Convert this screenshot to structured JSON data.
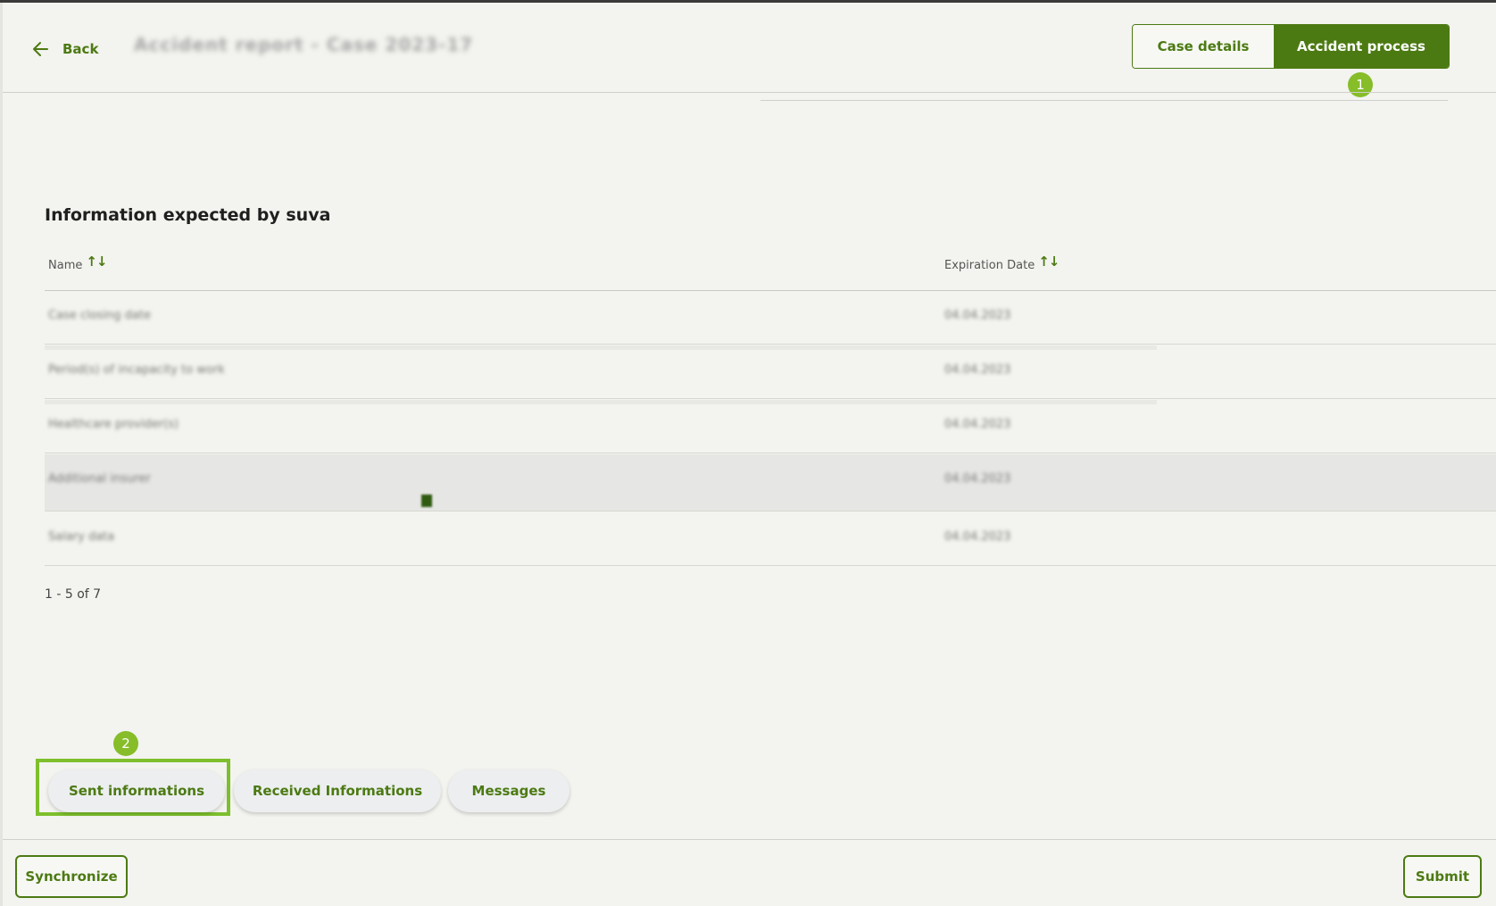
{
  "header": {
    "back_label": "Back",
    "case_title": "Accident report - Case 2023-17",
    "tabs": [
      {
        "label": "Case details",
        "active": false
      },
      {
        "label": "Accident process",
        "active": true
      }
    ]
  },
  "badges": {
    "one": "1",
    "two": "2"
  },
  "table": {
    "title": "Information expected by suva",
    "columns": [
      {
        "label": "Name",
        "sort_icon": "↑↓"
      },
      {
        "label": "Expiration Date",
        "sort_icon": "↑↓"
      }
    ],
    "rows": [
      {
        "name": "Case closing date",
        "date": "04.04.2023"
      },
      {
        "name": "Period(s) of incapacity to work",
        "date": "04.04.2023"
      },
      {
        "name": "Healthcare provider(s)",
        "date": "04.04.2023"
      },
      {
        "name": "Additional insurer",
        "date": "04.04.2023"
      },
      {
        "name": "Salary data",
        "date": "04.04.2023"
      }
    ],
    "pagination": "1 - 5 of 7"
  },
  "bottom_tabs": {
    "sent": "Sent informations",
    "received": "Received Informations",
    "messages": "Messages"
  },
  "footer": {
    "synchronize": "Synchronize",
    "submit": "Submit"
  },
  "colors": {
    "accent": "#4c7a12",
    "badge": "#86bd29",
    "background": "#f3f3ef"
  },
  "icons": [
    "arrow-left-icon",
    "sort-icon"
  ]
}
